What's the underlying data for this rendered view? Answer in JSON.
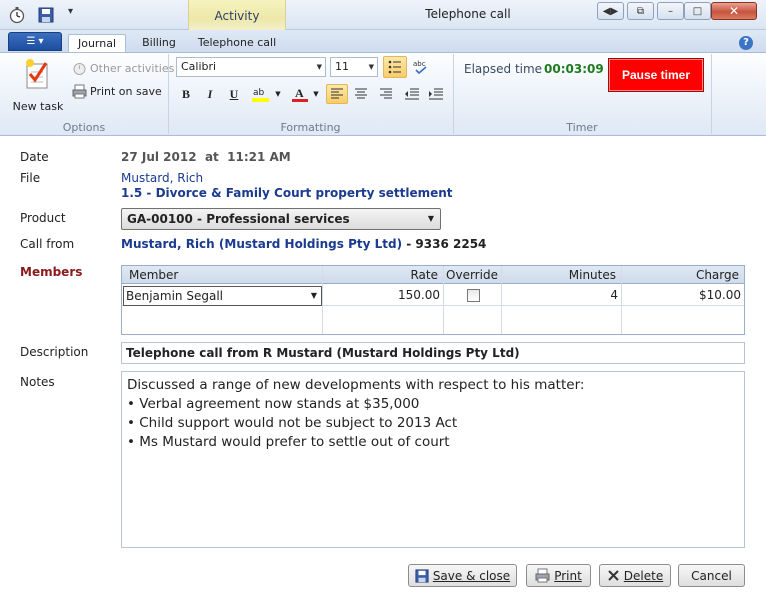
{
  "window": {
    "title": "Telephone call",
    "context_tab": "Activity"
  },
  "tabs": {
    "journal": "Journal",
    "billing": "Billing",
    "telephone_call": "Telephone call"
  },
  "ribbon": {
    "options": {
      "new_task": "New task",
      "other_activities": "Other activities",
      "print_on_save": "Print on save",
      "group_label": "Options"
    },
    "formatting": {
      "font": "Calibri",
      "size": "11",
      "group_label": "Formatting"
    },
    "timer": {
      "elapsed_label": "Elapsed time",
      "elapsed_value": "00:03:09",
      "pause_label": "Pause timer",
      "group_label": "Timer"
    }
  },
  "form": {
    "date": {
      "label": "Date",
      "date": "27 Jul 2012",
      "at": "at",
      "time": "11:21 AM"
    },
    "file": {
      "label": "File",
      "client": "Mustard, Rich",
      "matter": "1.5 - Divorce & Family Court property settlement"
    },
    "product": {
      "label": "Product",
      "value": "GA-00100 - Professional services"
    },
    "call_from": {
      "label": "Call from",
      "name": "Mustard, Rich (Mustard Holdings Pty Ltd)",
      "phone": "- 9336 2254"
    },
    "members": {
      "label": "Members",
      "columns": [
        "Member",
        "Rate",
        "Override",
        "Minutes",
        "Charge"
      ],
      "rows": [
        {
          "member": "Benjamin Segall",
          "rate": "150.00",
          "override": false,
          "minutes": "4",
          "charge": "$10.00"
        }
      ]
    },
    "description": {
      "label": "Description",
      "value": "Telephone call from R Mustard (Mustard Holdings Pty Ltd)"
    },
    "notes": {
      "label": "Notes",
      "lines": [
        "Discussed a range of new developments with respect to his matter:",
        "• Verbal agreement now stands at $35,000",
        "• Child support would not be subject to 2013 Act",
        "• Ms Mustard would prefer to settle out of court"
      ]
    }
  },
  "footer": {
    "save_close": "Save & close",
    "print": "Print",
    "delete": "Delete",
    "cancel": "Cancel"
  },
  "colors": {
    "pause": "#ff0000",
    "elapsed": "#1f7a1f",
    "members_label": "#8b1a1a",
    "link_blue": "#1a3b8f"
  }
}
